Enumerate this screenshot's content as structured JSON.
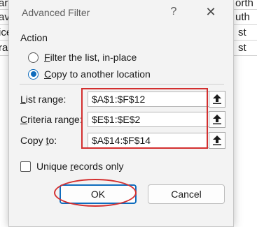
{
  "sheet": {
    "rows": [
      {
        "left": "aro",
        "right": "orth"
      },
      {
        "left": "avid",
        "right": "uth"
      },
      {
        "left": "ice",
        "right": "st"
      },
      {
        "left": "ra C",
        "right": "st"
      }
    ]
  },
  "dialog": {
    "title": "Advanced Filter",
    "help_glyph": "?",
    "close_glyph": "✕",
    "action_label": "Action",
    "options": [
      {
        "prefix": "",
        "accel": "F",
        "rest": "ilter the list, in-place",
        "selected": false
      },
      {
        "prefix": "",
        "accel": "C",
        "rest": "opy to another location",
        "selected": true
      }
    ],
    "list_range": {
      "accel": "L",
      "rest": "ist range:",
      "value": "$A$1:$F$12"
    },
    "criteria_range": {
      "accel": "C",
      "rest": "riteria range:",
      "value": "$E$1:$E$2"
    },
    "copy_to": {
      "prefix": "Copy ",
      "accel": "t",
      "rest": "o:",
      "value": "$A$14:$F$14"
    },
    "unique": {
      "prefix": "Unique ",
      "accel": "r",
      "rest": "ecords only",
      "checked": false
    },
    "ok_label": "OK",
    "cancel_label": "Cancel",
    "accent_color": "#0f6cbd",
    "annotation_color": "#d32f2f"
  }
}
